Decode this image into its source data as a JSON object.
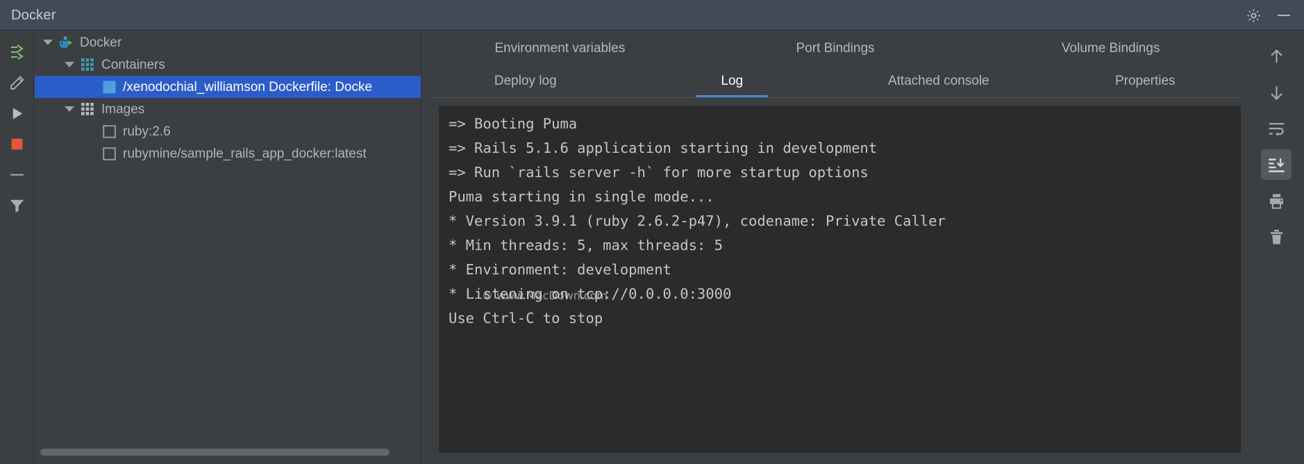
{
  "window": {
    "title": "Docker",
    "settings_icon": "gear-icon",
    "minimize_icon": "minimize-icon"
  },
  "left_toolbar": {
    "items": [
      {
        "name": "deploy-icon",
        "tooltip": "Deploy"
      },
      {
        "name": "edit-icon",
        "tooltip": "Edit Configuration"
      },
      {
        "name": "run-icon",
        "tooltip": "Run"
      },
      {
        "name": "stop-icon",
        "tooltip": "Stop"
      },
      {
        "name": "collapse-all-icon",
        "tooltip": "Collapse All"
      },
      {
        "name": "filter-icon",
        "tooltip": "Filter"
      }
    ]
  },
  "tree": {
    "rows": [
      {
        "label": "Docker",
        "indent": 0,
        "arrow": "expanded",
        "icon": "docker-whale-icon",
        "selected": false
      },
      {
        "label": "Containers",
        "indent": 1,
        "arrow": "expanded",
        "icon": "containers-grid-icon",
        "selected": false
      },
      {
        "label": "/xenodochial_williamson Dockerfile: Docke",
        "indent": 2,
        "arrow": "none",
        "icon": "container-square-icon",
        "selected": true
      },
      {
        "label": "Images",
        "indent": 1,
        "arrow": "expanded",
        "icon": "images-grid-icon",
        "selected": false
      },
      {
        "label": "ruby:2.6",
        "indent": 2,
        "arrow": "none",
        "icon": "image-square-icon",
        "selected": false
      },
      {
        "label": "rubymine/sample_rails_app_docker:latest",
        "indent": 2,
        "arrow": "none",
        "icon": "image-square-icon",
        "selected": false
      }
    ],
    "scrollbar": "horizontal-scrollbar"
  },
  "tabs": {
    "row1": [
      {
        "label": "Environment variables",
        "active": false
      },
      {
        "label": "Port Bindings",
        "active": false
      },
      {
        "label": "Volume Bindings",
        "active": false
      }
    ],
    "row2": [
      {
        "label": "Deploy log",
        "active": false
      },
      {
        "label": "Log",
        "active": true
      },
      {
        "label": "Attached console",
        "active": false
      },
      {
        "label": "Properties",
        "active": false
      }
    ],
    "active_accent": "#4a88d8"
  },
  "console": {
    "lines": [
      "=> Booting Puma",
      "=> Rails 5.1.6 application starting in development",
      "=> Run `rails server -h` for more startup options",
      "Puma starting in single mode...",
      "* Version 3.9.1 (ruby 2.6.2-p47), codename: Private Caller",
      "* Min threads: 5, max threads: 5",
      "* Environment: development",
      "* Listening on tcp://0.0.0.0:3000",
      "Use Ctrl-C to stop"
    ],
    "watermark": "© www.MacDown.com",
    "background": "#2b2b2b"
  },
  "right_toolbar": {
    "items": [
      {
        "name": "up-arrow-icon",
        "tooltip": "Previous Occurrence",
        "active": false
      },
      {
        "name": "down-arrow-icon",
        "tooltip": "Next Occurrence",
        "active": false
      },
      {
        "name": "soft-wrap-icon",
        "tooltip": "Soft-Wrap",
        "active": false
      },
      {
        "name": "scroll-to-end-icon",
        "tooltip": "Scroll to End",
        "active": true
      },
      {
        "name": "print-icon",
        "tooltip": "Print",
        "active": false
      },
      {
        "name": "trash-icon",
        "tooltip": "Clear All",
        "active": false
      }
    ]
  }
}
